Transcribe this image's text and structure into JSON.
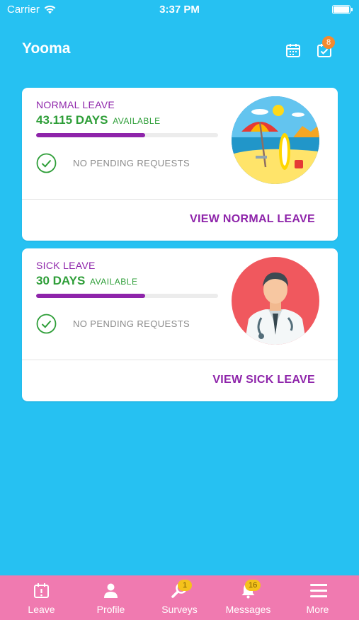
{
  "status_bar": {
    "carrier": "Carrier",
    "time": "3:37 PM"
  },
  "header": {
    "title": "Yooma",
    "tasks_badge": "8"
  },
  "cards": [
    {
      "type_label": "NORMAL LEAVE",
      "days": "43.115 DAYS",
      "available_label": "AVAILABLE",
      "progress_fraction": 0.6,
      "pending_text": "NO PENDING REQUESTS",
      "view_label": "VIEW NORMAL LEAVE",
      "illustration": "beach-illustration"
    },
    {
      "type_label": "SICK LEAVE",
      "days": "30 DAYS",
      "available_label": "AVAILABLE",
      "progress_fraction": 0.6,
      "pending_text": "NO PENDING REQUESTS",
      "view_label": "VIEW SICK LEAVE",
      "illustration": "doctor-illustration"
    }
  ],
  "tabs": [
    {
      "label": "Leave",
      "icon": "calendar-alert-icon"
    },
    {
      "label": "Profile",
      "icon": "person-icon"
    },
    {
      "label": "Surveys",
      "icon": "magnifier-icon",
      "badge": "1"
    },
    {
      "label": "Messages",
      "icon": "bell-icon",
      "badge": "16"
    },
    {
      "label": "More",
      "icon": "hamburger-icon"
    }
  ],
  "colors": {
    "background": "#26C1F2",
    "accent_purple": "#8E24AA",
    "days_green": "#2E9E38",
    "tab_bar": "#F07AB0",
    "header_badge": "#F48A2F",
    "tab_badge": "#F5C21B"
  }
}
